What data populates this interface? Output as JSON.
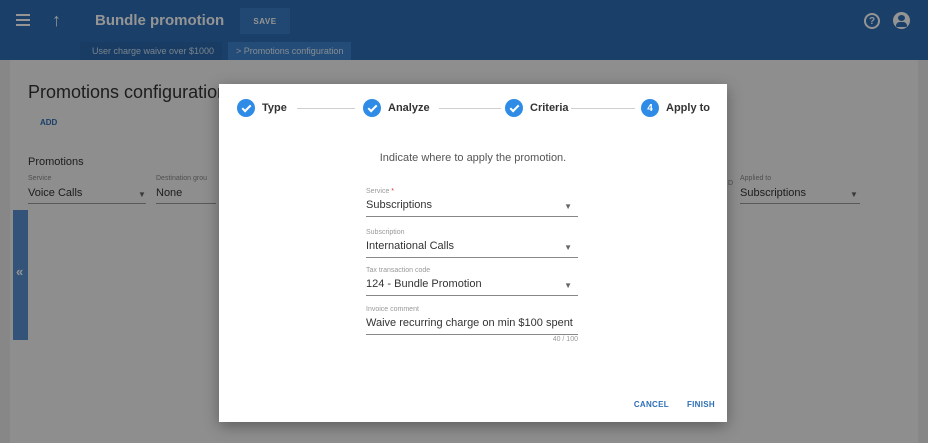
{
  "header": {
    "title": "Bundle promotion",
    "save_label": "SAVE"
  },
  "breadcrumb": {
    "items": [
      "User charge waive over $1000",
      "Promotions configuration"
    ],
    "separator": ">"
  },
  "page": {
    "title": "Promotions configuration",
    "add_label": "ADD",
    "section_label": "Promotions",
    "service": {
      "label": "Service",
      "value": "Voice Calls"
    },
    "destination": {
      "label": "Destination grou",
      "value": "None"
    },
    "applied_to": {
      "label": "Applied to",
      "value": "Subscriptions",
      "prefix": "D"
    },
    "collapse_glyph": "«"
  },
  "modal": {
    "steps": [
      {
        "label": "Type",
        "state": "done"
      },
      {
        "label": "Analyze",
        "state": "done"
      },
      {
        "label": "Criteria",
        "state": "done"
      },
      {
        "label": "Apply to",
        "number": "4",
        "state": "active"
      }
    ],
    "instruction": "Indicate where to apply the promotion.",
    "fields": {
      "service": {
        "label": "Service",
        "required_mark": "*",
        "value": "Subscriptions"
      },
      "subscription": {
        "label": "Subscription",
        "value": "International Calls"
      },
      "tax_code": {
        "label": "Tax transaction code",
        "value": "124 - Bundle Promotion"
      },
      "invoice_comment": {
        "label": "Invoice comment",
        "value": "Waive recurring charge on min $100 spent",
        "counter": "40 / 100"
      }
    },
    "cancel_label": "CANCEL",
    "finish_label": "FINISH"
  },
  "colors": {
    "primary": "#2e6fb5",
    "step_active": "#2e8ce6",
    "required": "#d33333"
  },
  "icons": [
    "menu-icon",
    "arrow-up-icon",
    "help-icon",
    "account-icon",
    "check-icon",
    "chevron-down-icon",
    "chevron-double-left-icon"
  ]
}
